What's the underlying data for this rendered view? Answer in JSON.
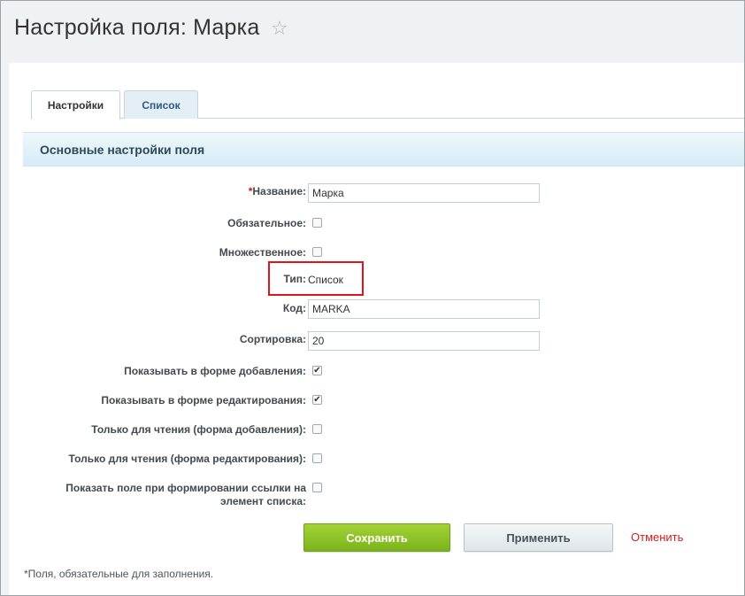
{
  "header": {
    "title": "Настройка поля: Марка",
    "star_icon": "☆"
  },
  "tabs": [
    {
      "label": "Настройки",
      "active": true
    },
    {
      "label": "Список",
      "active": false
    }
  ],
  "section": {
    "title": "Основные настройки поля"
  },
  "fields": {
    "name": {
      "required_mark": "*",
      "label": "Название:",
      "value": "Марка"
    },
    "required": {
      "label": "Обязательное:",
      "checked": false
    },
    "multiple": {
      "label": "Множественное:",
      "checked": false
    },
    "type": {
      "label": "Тип:",
      "value": "Список"
    },
    "code": {
      "label": "Код:",
      "value": "MARKA"
    },
    "sort": {
      "label": "Сортировка:",
      "value": "20"
    },
    "show_add": {
      "label": "Показывать в форме добавления:",
      "checked": true,
      "mark": "✔"
    },
    "show_edit": {
      "label": "Показывать в форме редактирования:",
      "checked": true,
      "mark": "✔"
    },
    "readonly_add": {
      "label": "Только для чтения (форма добавления):",
      "checked": false
    },
    "readonly_edit": {
      "label": "Только для чтения (форма редактирования):",
      "checked": false
    },
    "show_link": {
      "label_line1": "Показать поле при формировании ссылки на",
      "label_line2": "элемент списка:",
      "checked": false
    }
  },
  "buttons": {
    "save": "Сохранить",
    "apply": "Применить",
    "cancel": "Отменить"
  },
  "footnote": "*Поля, обязательные для заполнения.",
  "colors": {
    "save_button": "#8cc22a",
    "cancel_link": "#cf1f1f",
    "highlight": "#e0141e",
    "section_header": "#d6ecf6"
  }
}
